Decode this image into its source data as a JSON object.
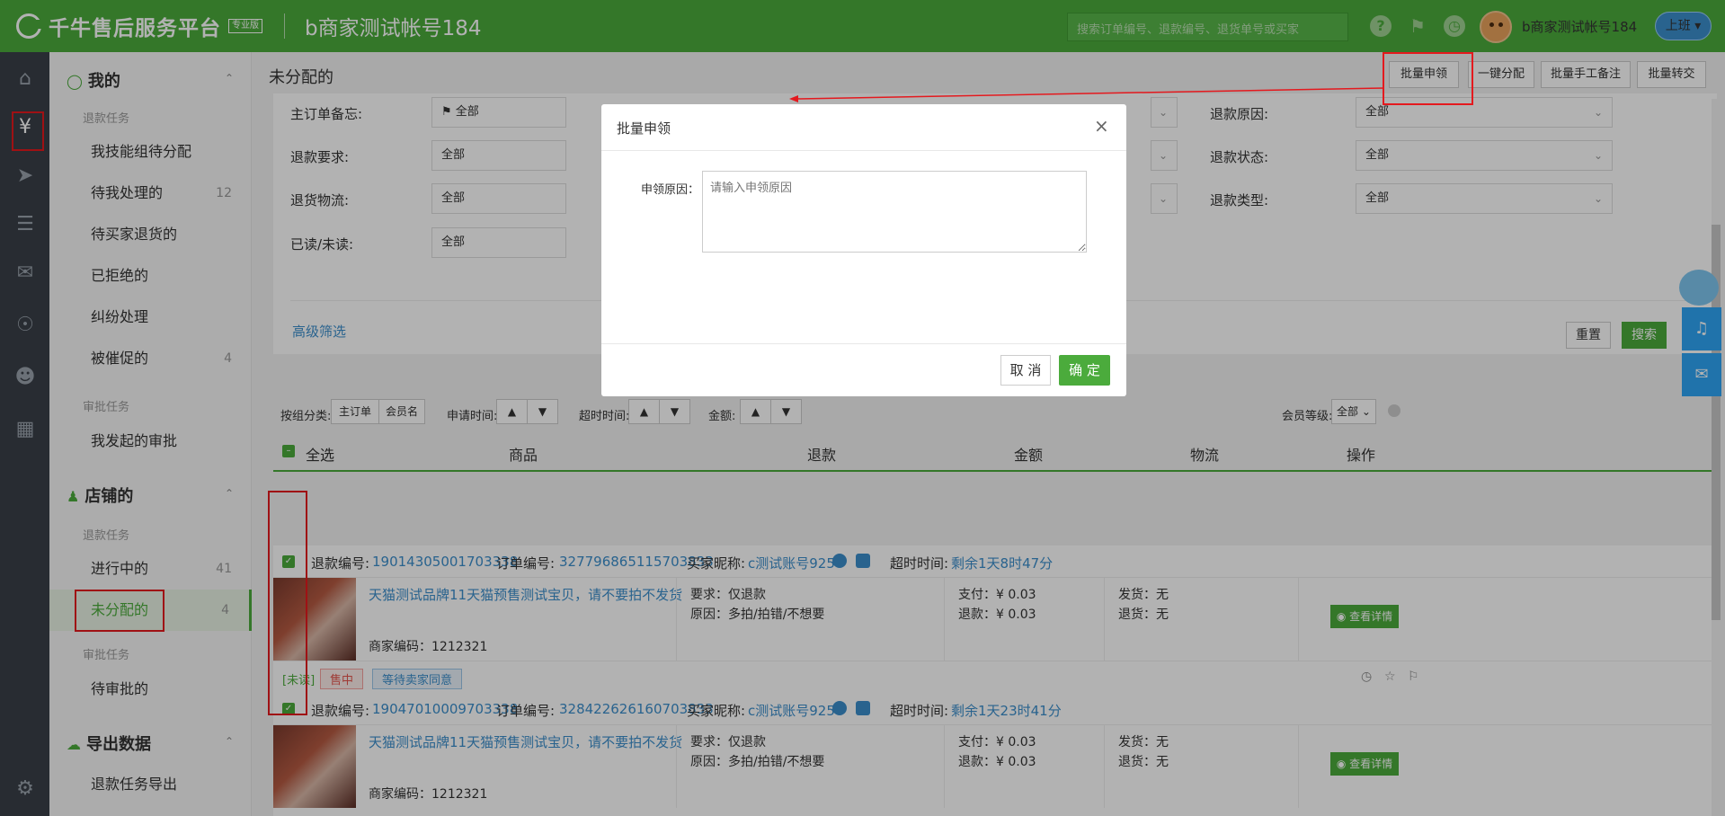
{
  "header": {
    "brand": "千牛售后服务平台",
    "brand_badge": "专业版",
    "account_title": "b商家测试帐号184",
    "search_placeholder": "搜索订单编号、退款编号、退货单号或买家",
    "user_name": "b商家测试帐号184",
    "shift_label": "上班",
    "help_glyph": "?"
  },
  "sidebar": {
    "groups": [
      {
        "label": "我的",
        "icon": "user-icon"
      },
      {
        "label": "店铺的",
        "icon": "shop-icon"
      },
      {
        "label": "导出数据",
        "icon": "cloud-download-icon"
      }
    ],
    "sections": [
      "退款任务",
      "审批任务",
      "退款任务",
      "审批任务"
    ],
    "items": [
      {
        "label": "我技能组待分配",
        "count": ""
      },
      {
        "label": "待我处理的",
        "count": "12"
      },
      {
        "label": "待买家退货的",
        "count": ""
      },
      {
        "label": "已拒绝的",
        "count": ""
      },
      {
        "label": "纠纷处理",
        "count": ""
      },
      {
        "label": "被催促的",
        "count": "4"
      },
      {
        "label": "我发起的审批",
        "count": ""
      },
      {
        "label": "进行中的",
        "count": "41"
      },
      {
        "label": "未分配的",
        "count": "4"
      },
      {
        "label": "待审批的",
        "count": ""
      },
      {
        "label": "退款任务导出",
        "count": ""
      }
    ]
  },
  "page": {
    "title": "未分配的",
    "actions": [
      "批量申领",
      "一键分配",
      "批量手工备注",
      "批量转交"
    ]
  },
  "filters": {
    "labels": [
      "主订单备忘:",
      "退款要求:",
      "退货物流:",
      "已读/未读:",
      "退款原因:",
      "退款状态:",
      "退款类型:"
    ],
    "all": "全部",
    "advanced": "高级筛选",
    "reset": "重置",
    "search": "搜索"
  },
  "sortbar": {
    "group_label": "按组分类:",
    "group_buttons": [
      "主订单",
      "会员名"
    ],
    "apply_time": "申请时间:",
    "timeout_time": "超时时间:",
    "amount": "金额:",
    "member_level": "会员等级:",
    "member_level_value": "全部"
  },
  "table": {
    "columns": [
      "全选",
      "商品",
      "退款",
      "金额",
      "物流",
      "操作"
    ]
  },
  "orders": [
    {
      "refund_label": "退款编号:",
      "refund_no": "19014305001703338",
      "order_label": "订单编号:",
      "order_no": "327796865115703833",
      "buyer_label": "买家昵称:",
      "buyer": "c测试账号925",
      "timeout_label": "超时时间:",
      "timeout": "剩余1天8时47分",
      "product": "天猫测试品牌11天猫预售测试宝贝，请不要拍不发货",
      "merchant_code": "商家编码：1212321",
      "requirement": "要求：仅退款",
      "reason": "原因：多拍/拍错/不想要",
      "paid": "支付：¥ 0.03",
      "refund": "退款：¥ 0.03",
      "ship": "发货：无",
      "return": "退货：无",
      "detail": "查看详情",
      "tags": [
        "[未读]",
        "售中",
        "等待卖家同意"
      ]
    },
    {
      "refund_label": "退款编号:",
      "refund_no": "19047010009703338",
      "order_label": "订单编号:",
      "order_no": "328422626160703833",
      "buyer_label": "买家昵称:",
      "buyer": "c测试账号925",
      "timeout_label": "超时时间:",
      "timeout": "剩余1天23时41分",
      "product": "天猫测试品牌11天猫预售测试宝贝，请不要拍不发货",
      "merchant_code": "商家编码：1212321",
      "requirement": "要求：仅退款",
      "reason": "原因：多拍/拍错/不想要",
      "paid": "支付：¥ 0.03",
      "refund": "退款：¥ 0.03",
      "ship": "发货：无",
      "return": "退货：无",
      "detail": "查看详情"
    }
  ],
  "modal": {
    "title": "批量申领",
    "field_label": "申领原因：",
    "placeholder": "请输入申领原因",
    "cancel": "取 消",
    "confirm": "确 定"
  },
  "colors": {
    "brand_green": "#4bab3c",
    "link_blue": "#3b8ecc",
    "annotation_red": "#e4191e"
  }
}
